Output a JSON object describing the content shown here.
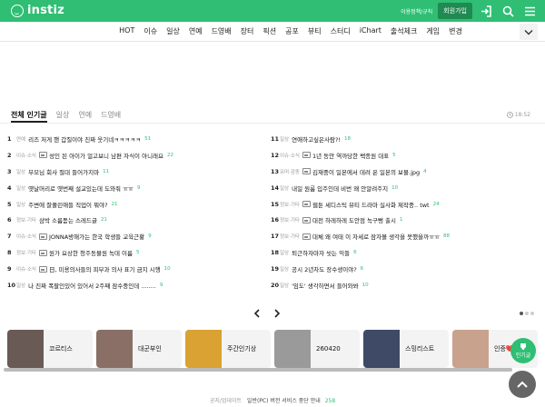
{
  "header": {
    "logo_text": "instiz",
    "policy_text": "이용정책/규칙",
    "join_label": "회원가입",
    "bg_color": "#2fbe74"
  },
  "nav": {
    "items": [
      "HOT",
      "이슈",
      "일상",
      "연예",
      "드영배",
      "장터",
      "픽션",
      "공포",
      "뷰티",
      "스터디",
      "iChart",
      "출석체크",
      "게임",
      "변경"
    ]
  },
  "tabs": {
    "items": [
      "전체 인기글",
      "일상",
      "연예",
      "드영배"
    ],
    "time": "18:52"
  },
  "posts_left": [
    {
      "rank": "1",
      "cat": "연예",
      "img": false,
      "title": "리즈 저게 핸 갑질이야 진짜 웃기네ㅋㅋㅋㅋㅋ",
      "count": "51"
    },
    {
      "rank": "2",
      "cat": "이슈·소식",
      "img": true,
      "title": "성인 된 아이가 얼고보니 남편 자식이 아니래요",
      "count": "22"
    },
    {
      "rank": "3",
      "cat": "일상",
      "img": false,
      "title": "부모님 회사 절대 들어가지마",
      "count": "11"
    },
    {
      "rank": "4",
      "cat": "일상",
      "img": false,
      "title": "옛날머리로 옛번째 설교있는데 도와줘 ㅠㅠ",
      "count": "9"
    },
    {
      "rank": "5",
      "cat": "일상",
      "img": false,
      "title": "주변에 잘풀린애들 직업이 뭐야?",
      "count": "21"
    },
    {
      "rank": "6",
      "cat": "정보·기타",
      "img": false,
      "title": "삼박 소름돋는 스레드글",
      "count": "21"
    },
    {
      "rank": "7",
      "cat": "이슈·소식",
      "img": true,
      "title": "JONNA방해가는 한국 학생들 교육근황",
      "count": "9"
    },
    {
      "rank": "8",
      "cat": "정보·기타",
      "img": true,
      "title": "원가 요상한 청주동물원 녹데 이름",
      "count": "5"
    },
    {
      "rank": "9",
      "cat": "이슈·소식",
      "img": true,
      "title": "日, 미용의사들의 피부과 의사 표기 금지 시행",
      "count": "10"
    },
    {
      "rank": "10",
      "cat": "일상",
      "img": false,
      "title": "나 진짜 폭팔인있어 있어서 2주째 잠수중인데 ........",
      "count": "9"
    }
  ],
  "posts_right": [
    {
      "rank": "11",
      "cat": "일상",
      "img": false,
      "title": "연애하고싶은사람?!",
      "count": "18"
    },
    {
      "rank": "12",
      "cat": "이슈·소식",
      "img": true,
      "title": "1년 동안 역까당한 백종원 대표",
      "count": "5"
    },
    {
      "rank": "13",
      "cat": "유머·감동",
      "img": true,
      "title": "김재중이 일본에서 데려 온 일본의 보물.jpg",
      "count": "4"
    },
    {
      "rank": "14",
      "cat": "일상",
      "img": false,
      "title": "내일 원룸 입주인데 비번 왜 안알려주지",
      "count": "10"
    },
    {
      "rank": "15",
      "cat": "정보·기타",
      "img": true,
      "title": "웹툰 세디스틱 뷰티 드라마 실사화 제작중.. twt",
      "count": "24"
    },
    {
      "rank": "16",
      "cat": "정보·기타",
      "img": true,
      "title": "대전 하레하레 도안점 녹구뻥 출시",
      "count": "1"
    },
    {
      "rank": "17",
      "cat": "정보·기타",
      "img": true,
      "title": "대체 왜 여태 이 자세로 잠자볼 생각을 못했을까ㅠㅠ",
      "count": "88"
    },
    {
      "rank": "18",
      "cat": "일상",
      "img": false,
      "title": "퇴근하자마자 씻는 익들",
      "count": "6"
    },
    {
      "rank": "19",
      "cat": "일상",
      "img": false,
      "title": "공시 2년차도 장수생이야?",
      "count": "6"
    },
    {
      "rank": "20",
      "cat": "일상",
      "img": false,
      "title": "'임도' 생각하면서 들어와봐",
      "count": "10"
    }
  ],
  "cards": [
    {
      "label": "코르티스",
      "color": "#6a5a55"
    },
    {
      "label": "대군부인",
      "color": "#8a6f66"
    },
    {
      "label": "주간인기상",
      "color": "#d9a233"
    },
    {
      "label": "260420",
      "color": "#9a9a9a"
    },
    {
      "label": "스밍리스트",
      "color": "#3f4a66"
    },
    {
      "label": "인증❤️",
      "color": "#c9a28e"
    }
  ],
  "fab": {
    "label": "인기글"
  },
  "footer": {
    "notice": "공지/업데이트",
    "message": "일반(PC) 버전 서비스 중단 안내",
    "count": "258"
  }
}
